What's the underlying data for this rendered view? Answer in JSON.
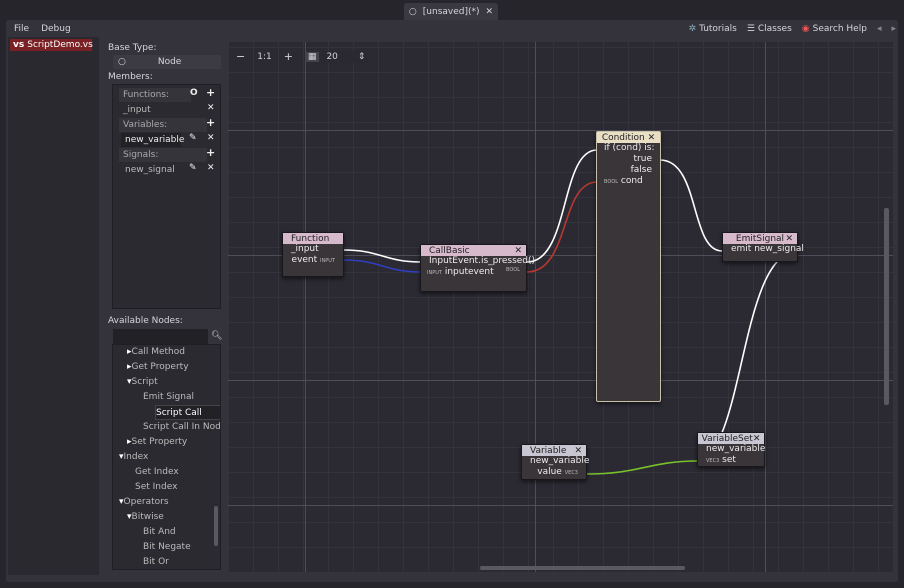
{
  "tab": {
    "title": "[unsaved](*)"
  },
  "menu": [
    "File",
    "Debug"
  ],
  "help": {
    "tutorials": "Tutorials",
    "classes": "Classes",
    "search_help": "Search Help"
  },
  "scripts": [
    {
      "badge": "vs",
      "name": "ScriptDemo.vs"
    }
  ],
  "side": {
    "base_type_label": "Base Type:",
    "base_type": "Node",
    "members_label": "Members:",
    "functions_label": "Functions:",
    "functions": [
      "_input"
    ],
    "variables_label": "Variables:",
    "variables": [
      "new_variable"
    ],
    "signals_label": "Signals:",
    "signals": [
      "new_signal"
    ],
    "available_label": "Available Nodes:",
    "search_value": "",
    "tree": [
      {
        "t": "Call Method",
        "l": 2,
        "a": "r"
      },
      {
        "t": "Get Property",
        "l": 2,
        "a": "r"
      },
      {
        "t": "Script",
        "l": 2,
        "a": "d"
      },
      {
        "t": "Emit Signal",
        "l": 3
      },
      {
        "t": "Script Call",
        "l": 3,
        "sel": true
      },
      {
        "t": "Script Call In Node",
        "l": 3
      },
      {
        "t": "Set Property",
        "l": 2,
        "a": "r"
      },
      {
        "t": "Index",
        "l": 1,
        "a": "d"
      },
      {
        "t": "Get Index",
        "l": 2
      },
      {
        "t": "Set Index",
        "l": 2
      },
      {
        "t": "Operators",
        "l": 1,
        "a": "d"
      },
      {
        "t": "Bitwise",
        "l": 2,
        "a": "d"
      },
      {
        "t": "Bit And",
        "l": 3
      },
      {
        "t": "Bit Negate",
        "l": 3
      },
      {
        "t": "Bit Or",
        "l": 3
      }
    ]
  },
  "toolbar": {
    "zoom_out": "−",
    "zoom_reset": "1:1",
    "zoom_in": "+",
    "snap": "20"
  },
  "nodes": {
    "function": {
      "title": "Function",
      "out": "_input",
      "event": "event",
      "type": "INPUT"
    },
    "callbasic": {
      "title": "CallBasic",
      "method": "InputEvent.is_pressed()",
      "arg": "inputevent",
      "in_type": "INPUT",
      "out_type": "BOOL"
    },
    "condition": {
      "title": "Condition",
      "line": "if (cond) is:",
      "t": "true",
      "f": "false",
      "cond": "cond",
      "type": "BOOL"
    },
    "emit": {
      "title": "EmitSignal",
      "line": "emit new_signal"
    },
    "variable": {
      "title": "Variable",
      "name": "new_variable",
      "value": "value",
      "type": "VEC3"
    },
    "varset": {
      "title": "VariableSet",
      "name": "new_variable",
      "set": "set",
      "type": "VEC3"
    }
  },
  "colors": {
    "accent": "#7a2125",
    "function_title": "#d7b9cc",
    "condition_title": "#e8dfc4",
    "variable_title": "#c7c6d2",
    "wire_bool": "#b8382f",
    "wire_input": "#2f3fbf",
    "wire_vec3": "#79c12b"
  }
}
